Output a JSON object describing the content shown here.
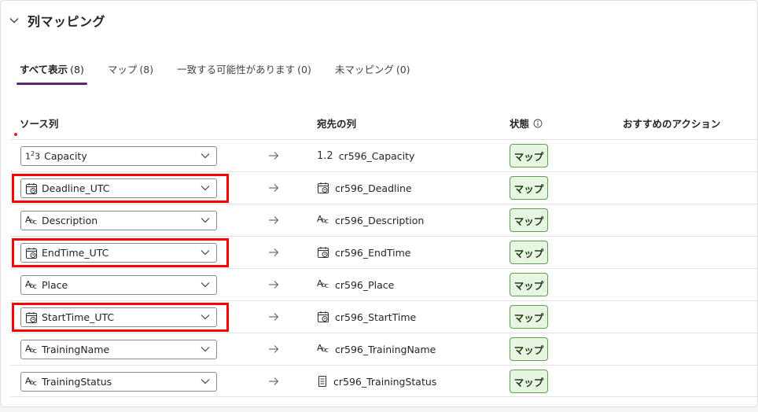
{
  "section": {
    "title": "列マッピング"
  },
  "tabs": [
    {
      "label": "すべて表示",
      "count": "(8)"
    },
    {
      "label": "マップ",
      "count": "(8)"
    },
    {
      "label": "一致する可能性があります",
      "count": "(0)"
    },
    {
      "label": "未マッピング",
      "count": "(0)"
    }
  ],
  "columns": {
    "source": "ソース列",
    "destination": "宛先の列",
    "status": "状態",
    "action": "おすすめのアクション"
  },
  "rows": [
    {
      "source": "Capacity",
      "source_icon": "number-icon",
      "destination": "cr596_Capacity",
      "dest_icon": "decimal-icon",
      "dest_glyph": "1.2",
      "status": "マップ",
      "highlighted": false
    },
    {
      "source": "Deadline_UTC",
      "source_icon": "datetime-icon",
      "destination": "cr596_Deadline",
      "dest_icon": "datetime-icon",
      "status": "マップ",
      "highlighted": true
    },
    {
      "source": "Description",
      "source_icon": "text-icon",
      "destination": "cr596_Description",
      "dest_icon": "text-icon",
      "status": "マップ",
      "highlighted": false
    },
    {
      "source": "EndTime_UTC",
      "source_icon": "datetime-icon",
      "destination": "cr596_EndTime",
      "dest_icon": "datetime-icon",
      "status": "マップ",
      "highlighted": true
    },
    {
      "source": "Place",
      "source_icon": "text-icon",
      "destination": "cr596_Place",
      "dest_icon": "text-icon",
      "status": "マップ",
      "highlighted": false
    },
    {
      "source": "StartTime_UTC",
      "source_icon": "datetime-icon",
      "destination": "cr596_StartTime",
      "dest_icon": "datetime-icon",
      "status": "マップ",
      "highlighted": true
    },
    {
      "source": "TrainingName",
      "source_icon": "text-icon",
      "destination": "cr596_TrainingName",
      "dest_icon": "text-icon",
      "status": "マップ",
      "highlighted": false
    },
    {
      "source": "TrainingStatus",
      "source_icon": "text-icon",
      "destination": "cr596_TrainingStatus",
      "dest_icon": "choice-icon",
      "status": "マップ",
      "highlighted": false
    }
  ],
  "colors": {
    "accent": "#5b2a6e",
    "highlight": "#ff0000",
    "status_bg": "#e8f5e3",
    "status_border": "#5aa24c"
  }
}
